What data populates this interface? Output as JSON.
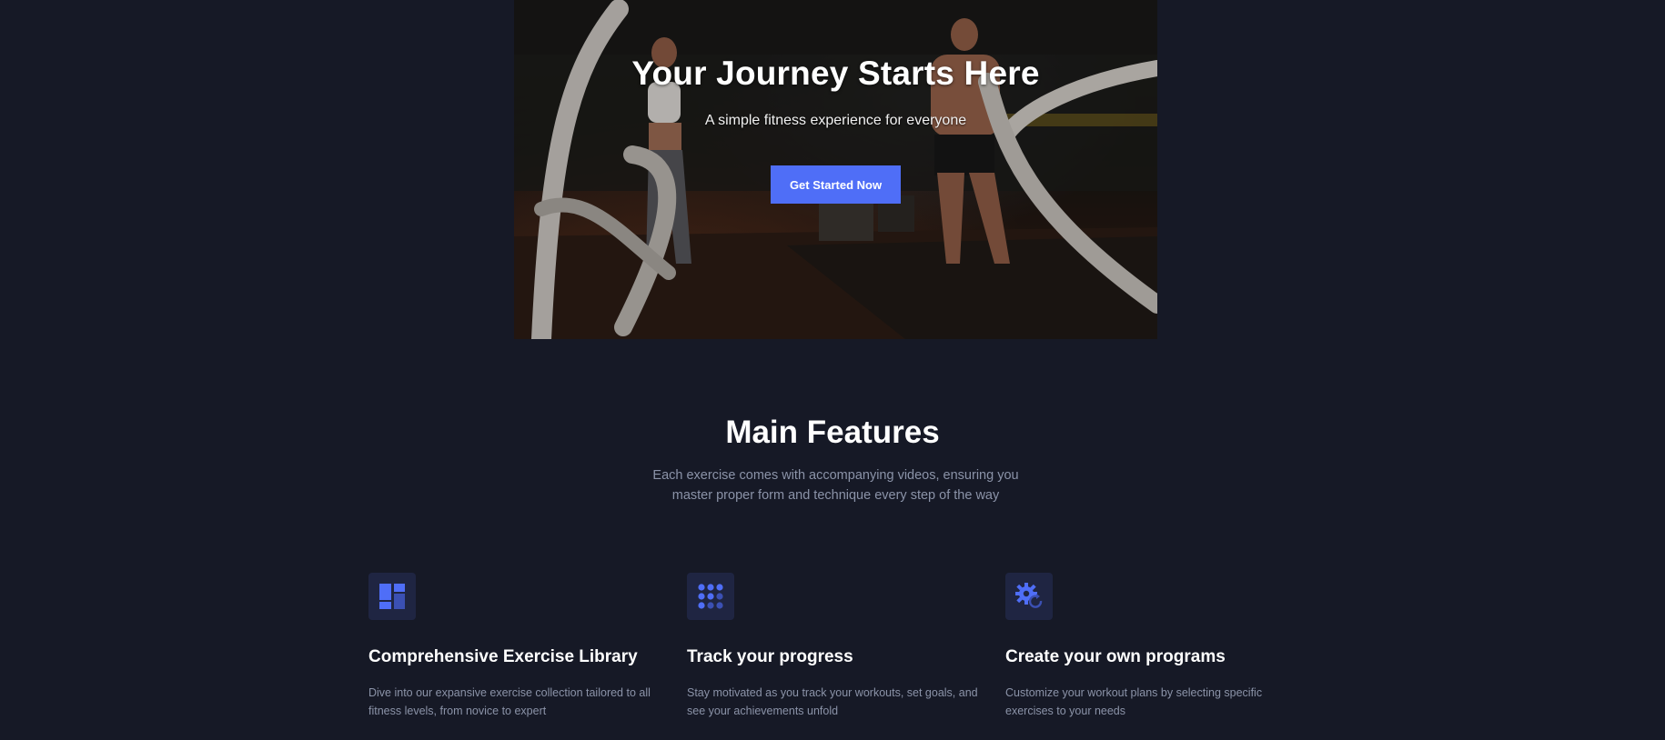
{
  "hero": {
    "title": "Your Journey Starts Here",
    "subtitle": "A simple fitness experience for everyone",
    "cta_label": "Get Started Now"
  },
  "features": {
    "title": "Main Features",
    "description": "Each exercise comes with accompanying videos, ensuring you master proper form and technique every step of the way",
    "items": [
      {
        "icon": "dashboard-icon",
        "title": "Comprehensive Exercise Library",
        "description": "Dive into our expansive exercise collection tailored to all fitness levels, from novice to expert"
      },
      {
        "icon": "grid-dots-icon",
        "title": "Track your progress",
        "description": "Stay motivated as you track your workouts, set goals, and see your achievements unfold"
      },
      {
        "icon": "gear-refresh-icon",
        "title": "Create your own programs",
        "description": "Customize your workout plans by selecting specific exercises to your needs"
      }
    ]
  },
  "colors": {
    "background": "#161926",
    "accent": "#4f6ef7",
    "muted_text": "#8b93a8",
    "icon_box": "#1f2542"
  }
}
